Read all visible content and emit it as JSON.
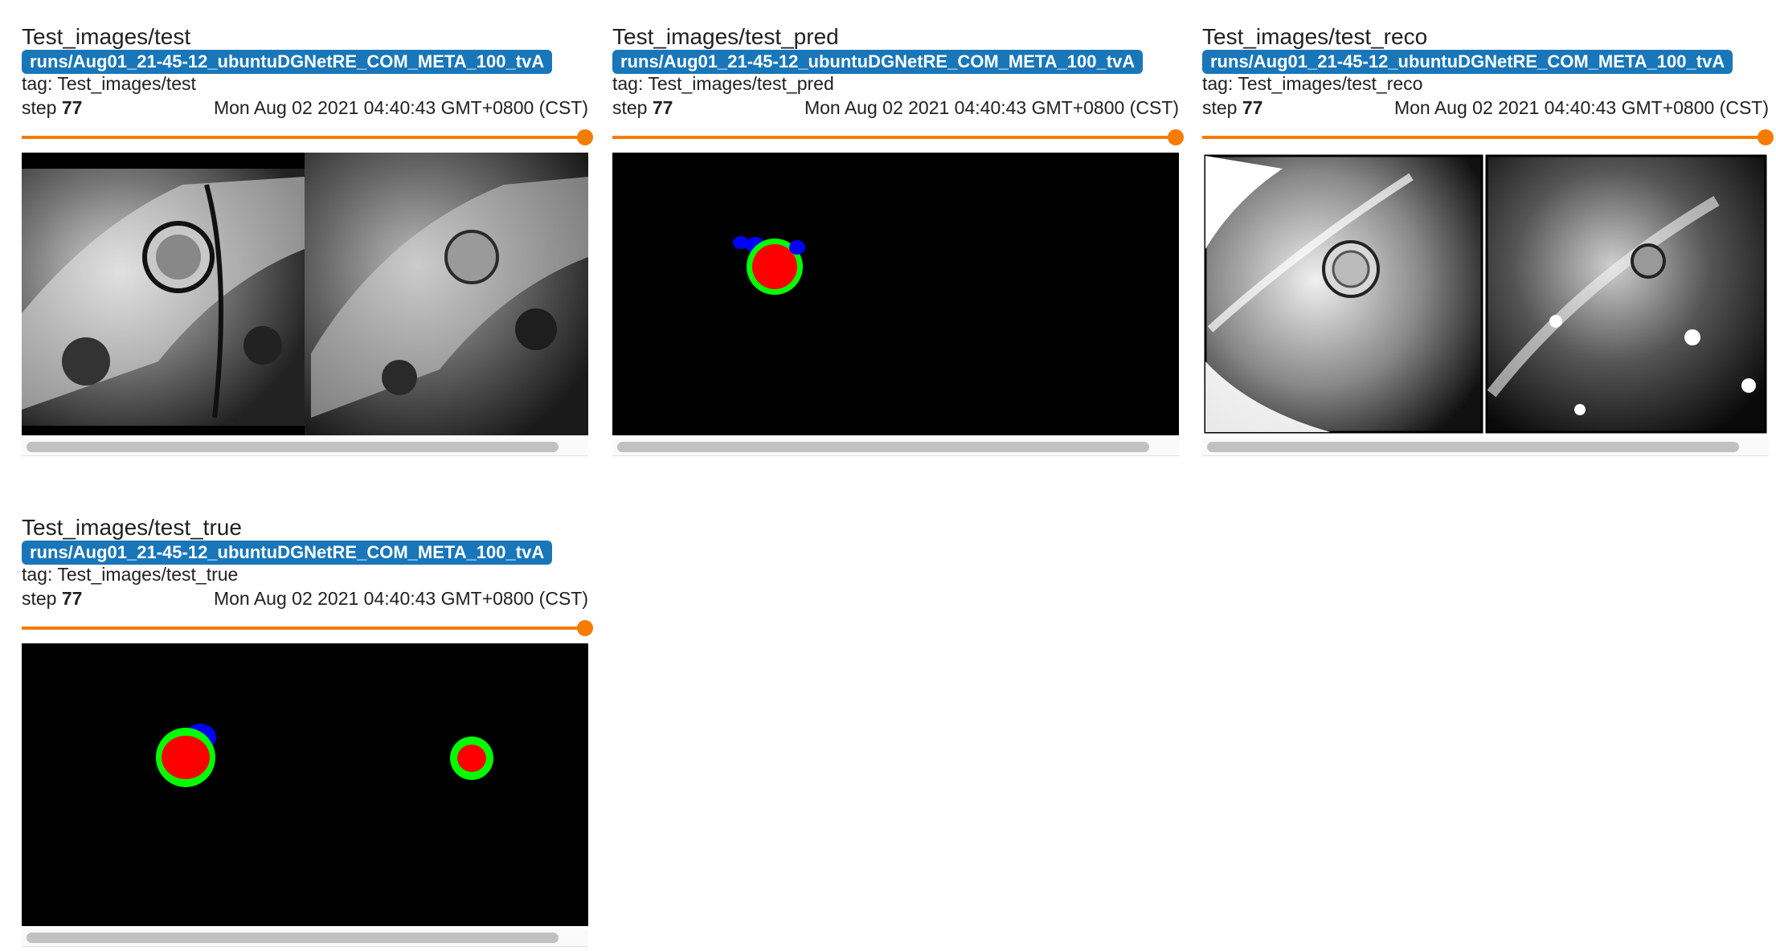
{
  "cards": [
    {
      "title": "Test_images/test",
      "run": "runs/Aug01_21-45-12_ubuntuDGNetRE_COM_META_100_tvA",
      "tag": "tag: Test_images/test",
      "step_label": "step",
      "step_value": "77",
      "timestamp": "Mon Aug 02 2021 04:40:43 GMT+0800 (CST)",
      "image": "grayscale cardiac MRI slices"
    },
    {
      "title": "Test_images/test_pred",
      "run": "runs/Aug01_21-45-12_ubuntuDGNetRE_COM_META_100_tvA",
      "tag": "tag: Test_images/test_pred",
      "step_label": "step",
      "step_value": "77",
      "timestamp": "Mon Aug 02 2021 04:40:43 GMT+0800 (CST)",
      "image": "predicted segmentation mask"
    },
    {
      "title": "Test_images/test_reco",
      "run": "runs/Aug01_21-45-12_ubuntuDGNetRE_COM_META_100_tvA",
      "tag": "tag: Test_images/test_reco",
      "step_label": "step",
      "step_value": "77",
      "timestamp": "Mon Aug 02 2021 04:40:43 GMT+0800 (CST)",
      "image": "reconstructed MRI slices"
    },
    {
      "title": "Test_images/test_true",
      "run": "runs/Aug01_21-45-12_ubuntuDGNetRE_COM_META_100_tvA",
      "tag": "tag: Test_images/test_true",
      "step_label": "step",
      "step_value": "77",
      "timestamp": "Mon Aug 02 2021 04:40:43 GMT+0800 (CST)",
      "image": "ground truth segmentation mask"
    }
  ],
  "colors": {
    "run_badge": "#1976b9",
    "slider": "#f57c00",
    "mask_red": "#ff0000",
    "mask_green": "#00ff00",
    "mask_blue": "#0000ff"
  },
  "slider_position": 1.0
}
